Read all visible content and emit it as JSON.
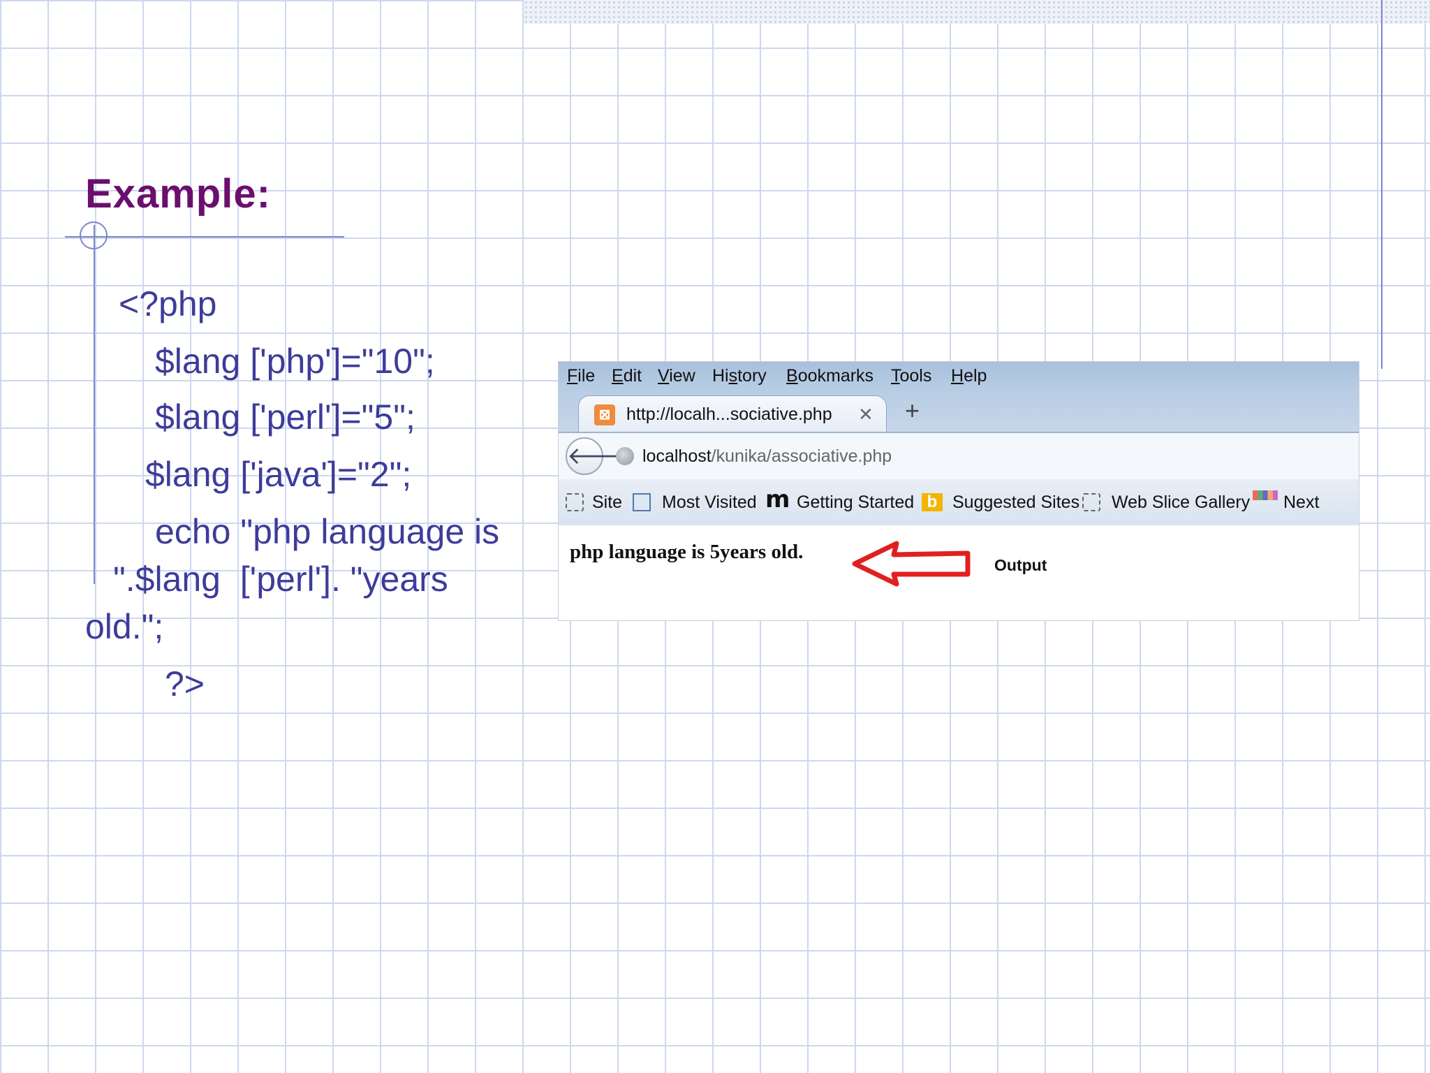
{
  "slide": {
    "title": "Example:",
    "code_lines": [
      "<?php",
      "$lang ['php']=\"10\";",
      "$lang ['perl']=\"5\";",
      "$lang ['java']=\"2\";",
      "echo \"php language is",
      "\".$lang  ['perl']. \"years",
      "old.\";",
      "?>"
    ]
  },
  "browser": {
    "menu": [
      {
        "underline": "F",
        "rest": "ile"
      },
      {
        "underline": "E",
        "rest": "dit"
      },
      {
        "underline": "V",
        "rest": "iew"
      },
      {
        "pre": "Hi",
        "underline": "s",
        "rest": "tory"
      },
      {
        "underline": "B",
        "rest": "ookmarks"
      },
      {
        "underline": "T",
        "rest": "ools"
      },
      {
        "underline": "H",
        "rest": "elp"
      }
    ],
    "tab": {
      "title": "http://localh...sociative.php",
      "close": "✕"
    },
    "new_tab": "+",
    "address": {
      "host": "localhost",
      "path": "/kunika/associative.php"
    },
    "bookmarks": [
      "Site",
      "Most Visited",
      "Getting Started",
      "Suggested Sites",
      "Web Slice Gallery",
      "Next"
    ],
    "page_output": "php language is 5years old.",
    "annotation": "Output",
    "arrow_color": "#e02020"
  }
}
